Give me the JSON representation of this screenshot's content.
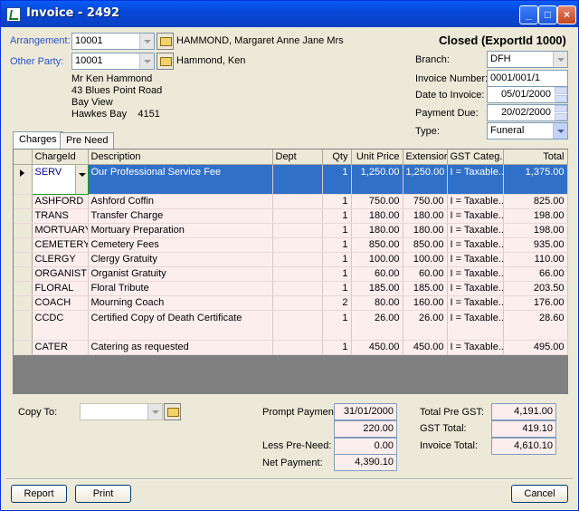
{
  "window": {
    "title": "Invoice - 2492"
  },
  "header": {
    "arrangement_label": "Arrangement:",
    "arrangement_value": "10001",
    "arrangement_name": "HAMMOND, Margaret Anne Jane Mrs",
    "other_party_label": "Other Party:",
    "other_party_value": "10001",
    "other_party_name": "Hammond, Ken",
    "address": [
      "Mr Ken Hammond",
      "43 Blues Point Road",
      "Bay View",
      "Hawkes Bay    4151"
    ],
    "status": "Closed (ExportId 1000)"
  },
  "details": {
    "branch_label": "Branch:",
    "branch_value": "DFH",
    "invoice_number_label": "Invoice Number:",
    "invoice_number_value": "0001/001/1",
    "date_label": "Date to Invoice:",
    "date_value": "05/01/2000",
    "due_label": "Payment Due:",
    "due_value": "20/02/2000",
    "type_label": "Type:",
    "type_value": "Funeral"
  },
  "tabs": [
    "Charges",
    "Pre Need"
  ],
  "grid": {
    "columns": [
      "ChargeId",
      "Description",
      "Dept",
      "Qty",
      "Unit Price",
      "Extension",
      "GST Categ...",
      "Total"
    ],
    "rows": [
      [
        "SERV",
        "Our Professional Service Fee",
        "",
        "1",
        "1,250.00",
        "1,250.00",
        "I = Taxable...",
        "1,375.00"
      ],
      [
        "ASHFORD",
        "Ashford Coffin",
        "",
        "1",
        "750.00",
        "750.00",
        "I = Taxable...",
        "825.00"
      ],
      [
        "TRANS",
        "Transfer Charge",
        "",
        "1",
        "180.00",
        "180.00",
        "I = Taxable...",
        "198.00"
      ],
      [
        "MORTUARY",
        "Mortuary Preparation",
        "",
        "1",
        "180.00",
        "180.00",
        "I = Taxable...",
        "198.00"
      ],
      [
        "CEMETERY",
        "Cemetery Fees",
        "",
        "1",
        "850.00",
        "850.00",
        "I = Taxable...",
        "935.00"
      ],
      [
        "CLERGY",
        "Clergy Gratuity",
        "",
        "1",
        "100.00",
        "100.00",
        "I = Taxable...",
        "110.00"
      ],
      [
        "ORGANIST",
        "Organist Gratuity",
        "",
        "1",
        "60.00",
        "60.00",
        "I = Taxable...",
        "66.00"
      ],
      [
        "FLORAL",
        "Floral Tribute",
        "",
        "1",
        "185.00",
        "185.00",
        "I = Taxable...",
        "203.50"
      ],
      [
        "COACH",
        "Mourning Coach",
        "",
        "2",
        "80.00",
        "160.00",
        "I = Taxable...",
        "176.00"
      ],
      [
        "CCDC",
        "Certified Copy of Death Certificate",
        "",
        "1",
        "26.00",
        "26.00",
        "I = Taxable...",
        "28.60"
      ],
      [
        "CATER",
        "Catering as requested",
        "",
        "1",
        "450.00",
        "450.00",
        "I = Taxable...",
        "495.00"
      ]
    ]
  },
  "footer": {
    "copy_to_label": "Copy To:",
    "copy_to_value": "",
    "prompt_payment_label": "Prompt Payment:",
    "prompt_payment_date": "31/01/2000",
    "prompt_payment_amount": "220.00",
    "less_preneed_label": "Less Pre-Need:",
    "less_preneed_value": "0.00",
    "net_payment_label": "Net Payment:",
    "net_payment_value": "4,390.10",
    "total_pre_gst_label": "Total Pre GST:",
    "total_pre_gst_value": "4,191.00",
    "gst_total_label": "GST Total:",
    "gst_total_value": "419.10",
    "invoice_total_label": "Invoice Total:",
    "invoice_total_value": "4,610.10"
  },
  "buttons": {
    "report": "Report",
    "print": "Print",
    "cancel": "Cancel"
  },
  "colors": {
    "selection": "#3170c8",
    "row_background": "#fdeeee",
    "titlebar": "#0548d8",
    "link": "#2a52c8"
  }
}
